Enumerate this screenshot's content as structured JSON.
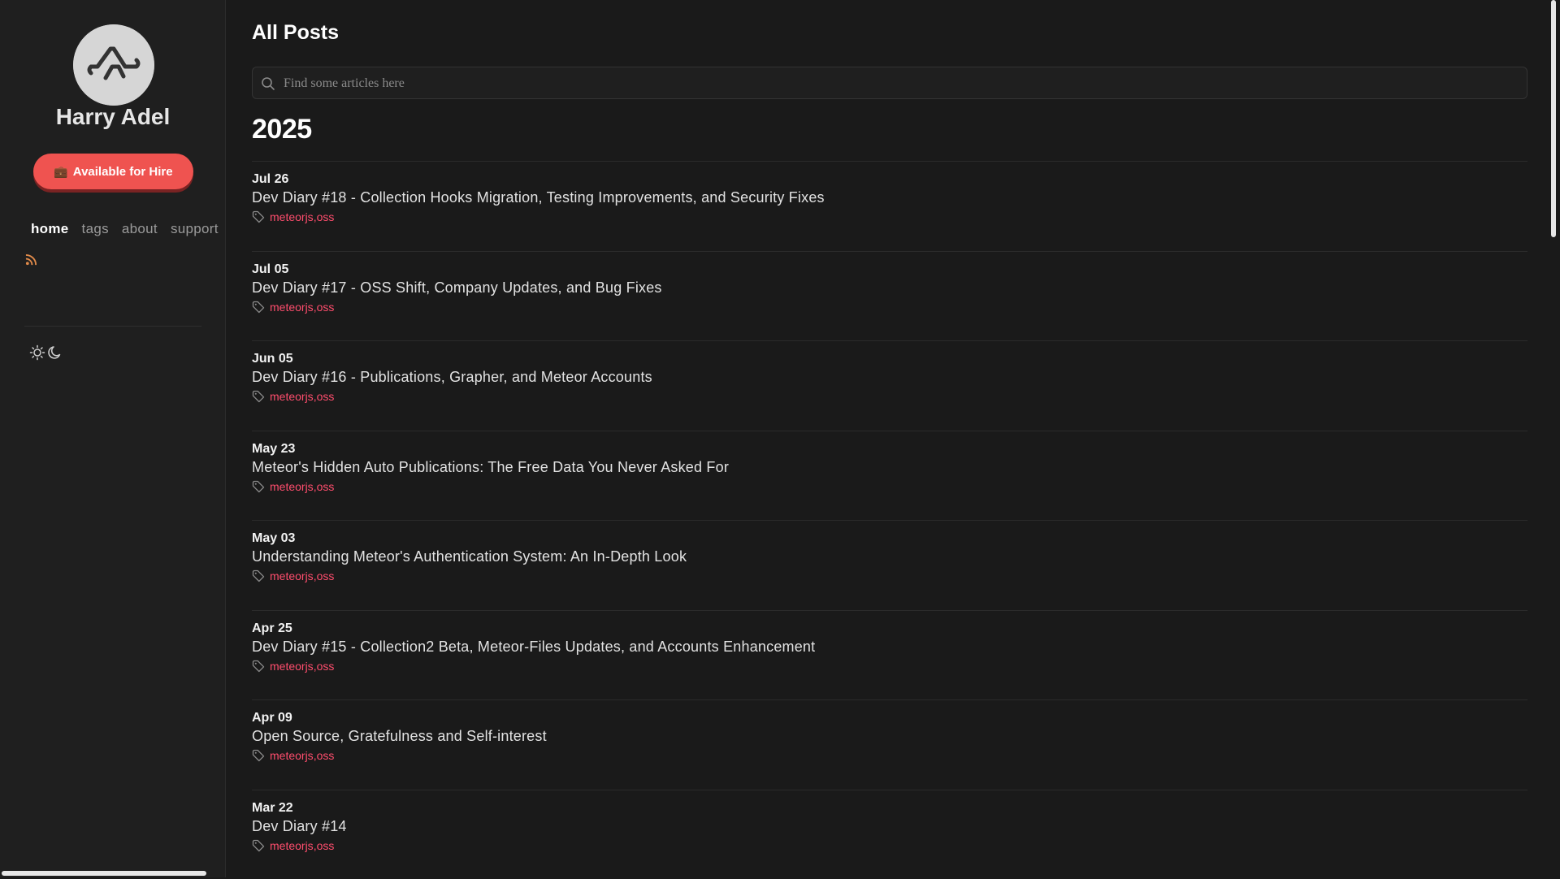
{
  "sidebar": {
    "site_name": "Harry Adel",
    "hire_button": {
      "icon": "briefcase-icon",
      "label": "Available for Hire"
    },
    "nav": [
      {
        "label": "home",
        "active": true
      },
      {
        "label": "tags",
        "active": false
      },
      {
        "label": "about",
        "active": false
      },
      {
        "label": "support",
        "active": false
      }
    ],
    "rss_icon": "rss-icon",
    "theme_icons": [
      "sun-icon",
      "moon-icon"
    ]
  },
  "main": {
    "title": "All Posts",
    "search": {
      "placeholder": "Find some articles here",
      "value": ""
    },
    "year": "2025",
    "posts": [
      {
        "date": "Jul 26",
        "title": "Dev Diary #18 - Collection Hooks Migration, Testing Improvements, and Security Fixes",
        "tags": [
          "meteorjs",
          "oss"
        ]
      },
      {
        "date": "Jul 05",
        "title": "Dev Diary #17 - OSS Shift, Company Updates, and Bug Fixes",
        "tags": [
          "meteorjs",
          "oss"
        ]
      },
      {
        "date": "Jun 05",
        "title": "Dev Diary #16 - Publications, Grapher, and Meteor Accounts",
        "tags": [
          "meteorjs",
          "oss"
        ]
      },
      {
        "date": "May 23",
        "title": "Meteor's Hidden Auto Publications: The Free Data You Never Asked For",
        "tags": [
          "meteorjs",
          "oss"
        ]
      },
      {
        "date": "May 03",
        "title": "Understanding Meteor's Authentication System: An In-Depth Look",
        "tags": [
          "meteorjs",
          "oss"
        ]
      },
      {
        "date": "Apr 25",
        "title": "Dev Diary #15 - Collection2 Beta, Meteor-Files Updates, and Accounts Enhancement",
        "tags": [
          "meteorjs",
          "oss"
        ]
      },
      {
        "date": "Apr 09",
        "title": "Open Source, Gratefulness and Self-interest",
        "tags": [
          "meteorjs",
          "oss"
        ]
      },
      {
        "date": "Mar 22",
        "title": "Dev Diary #14",
        "tags": [
          "meteorjs",
          "oss"
        ]
      }
    ]
  },
  "colors": {
    "background": "#1a1a1a",
    "accent_tag": "#ff4d6d",
    "hire_button": "#ef5350"
  }
}
